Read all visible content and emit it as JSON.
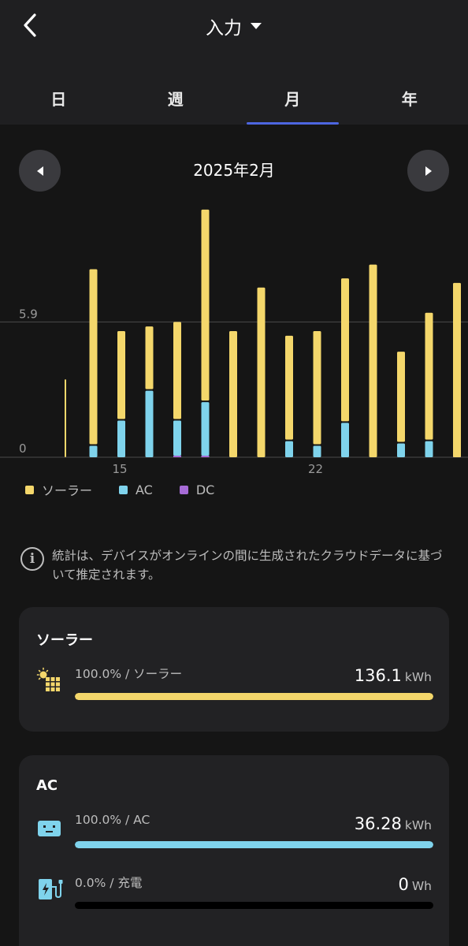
{
  "header": {
    "title": "入力",
    "tabs": [
      {
        "label": "日",
        "active": false
      },
      {
        "label": "週",
        "active": false
      },
      {
        "label": "月",
        "active": true
      },
      {
        "label": "年",
        "active": false
      }
    ]
  },
  "period": {
    "label": "2025年2月"
  },
  "colors": {
    "solar": "#f4d76b",
    "ac": "#7fd3ec",
    "dc": "#a66bd6",
    "accent": "#4d66e0"
  },
  "chart_data": {
    "type": "bar",
    "stacked": true,
    "reference_line": {
      "label": "5.9",
      "value": 5.9
    },
    "y_zero_label": "0",
    "x_tick_labels": [
      {
        "day": 15,
        "label": "15"
      },
      {
        "day": 22,
        "label": "22"
      }
    ],
    "ylim": [
      0,
      11
    ],
    "days": [
      13,
      14,
      15,
      16,
      17,
      18,
      19,
      20,
      21,
      22,
      23,
      24,
      25,
      26,
      27,
      28
    ],
    "series": [
      {
        "name": "ソーラー",
        "key": "solar",
        "values": [
          3.4,
          7.7,
          3.9,
          2.8,
          4.3,
          8.4,
          5.5,
          7.4,
          4.6,
          5.0,
          6.3,
          8.4,
          4.0,
          5.6,
          7.6,
          0.0
        ]
      },
      {
        "name": "AC",
        "key": "ac",
        "values": [
          0.0,
          0.5,
          1.6,
          2.9,
          1.6,
          2.4,
          0.0,
          0.0,
          0.7,
          0.5,
          1.5,
          0.0,
          0.6,
          0.7,
          0.0,
          0.0
        ]
      },
      {
        "name": "DC",
        "key": "dc",
        "values": [
          0.0,
          0.0,
          0.0,
          0.0,
          0.05,
          0.05,
          0.0,
          0.0,
          0.0,
          0.0,
          0.0,
          0.0,
          0.0,
          0.0,
          0.05,
          0.0
        ]
      }
    ]
  },
  "legend": [
    {
      "label": "ソーラー",
      "color": "#f4d76b"
    },
    {
      "label": "AC",
      "color": "#7fd3ec"
    },
    {
      "label": "DC",
      "color": "#a66bd6"
    }
  ],
  "info": {
    "text": "統計は、デバイスがオンラインの間に生成されたクラウドデータに基づいて推定されます。"
  },
  "solar_card": {
    "title": "ソーラー",
    "row": {
      "icon": "solar-panel-icon",
      "label": "100.0% / ソーラー",
      "value": "136.1",
      "unit": "kWh",
      "fraction": 1.0
    }
  },
  "ac_card": {
    "title": "AC",
    "rows": [
      {
        "icon": "ac-outlet-icon",
        "label": "100.0% / AC",
        "value": "36.28",
        "unit": "kWh",
        "fraction": 1.0
      },
      {
        "icon": "ev-charger-icon",
        "label": "0.0% / 充電",
        "value": "0",
        "unit": "Wh",
        "fraction": 0.0
      }
    ]
  }
}
